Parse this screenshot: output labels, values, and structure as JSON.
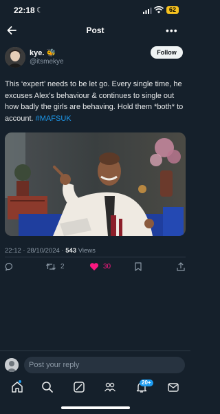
{
  "status_bar": {
    "time": "22:18",
    "battery": "62"
  },
  "header": {
    "title": "Post"
  },
  "author": {
    "name": "kye. 🐝",
    "handle": "@itsmekye"
  },
  "follow_label": "Follow",
  "post": {
    "text": "This ‘expert’ needs to be let go. Every single time, he excuses Alex’s behaviour & continues to single out how badly the girls are behaving. Hold them *both* to account. ",
    "hashtag": "#MAFSUK"
  },
  "meta": {
    "datetime": "22:12 · 28/10/2024 · ",
    "views_count": "543",
    "views_label": " Views"
  },
  "actions": {
    "reposts": "2",
    "likes": "30"
  },
  "reply": {
    "placeholder": "Post your reply"
  },
  "tabbar": {
    "notifications_badge": "20+"
  },
  "colors": {
    "background": "#15202b",
    "accent": "#1d9bf0",
    "like": "#f91880",
    "battery": "#f7c21f"
  },
  "icons": [
    "moon-icon",
    "signal-icon",
    "wifi-icon",
    "back-arrow-icon",
    "more-icon",
    "reply-icon",
    "repost-icon",
    "heart-icon",
    "bookmark-icon",
    "share-icon",
    "home-icon",
    "search-icon",
    "grok-icon",
    "communities-icon",
    "bell-icon",
    "mail-icon"
  ]
}
